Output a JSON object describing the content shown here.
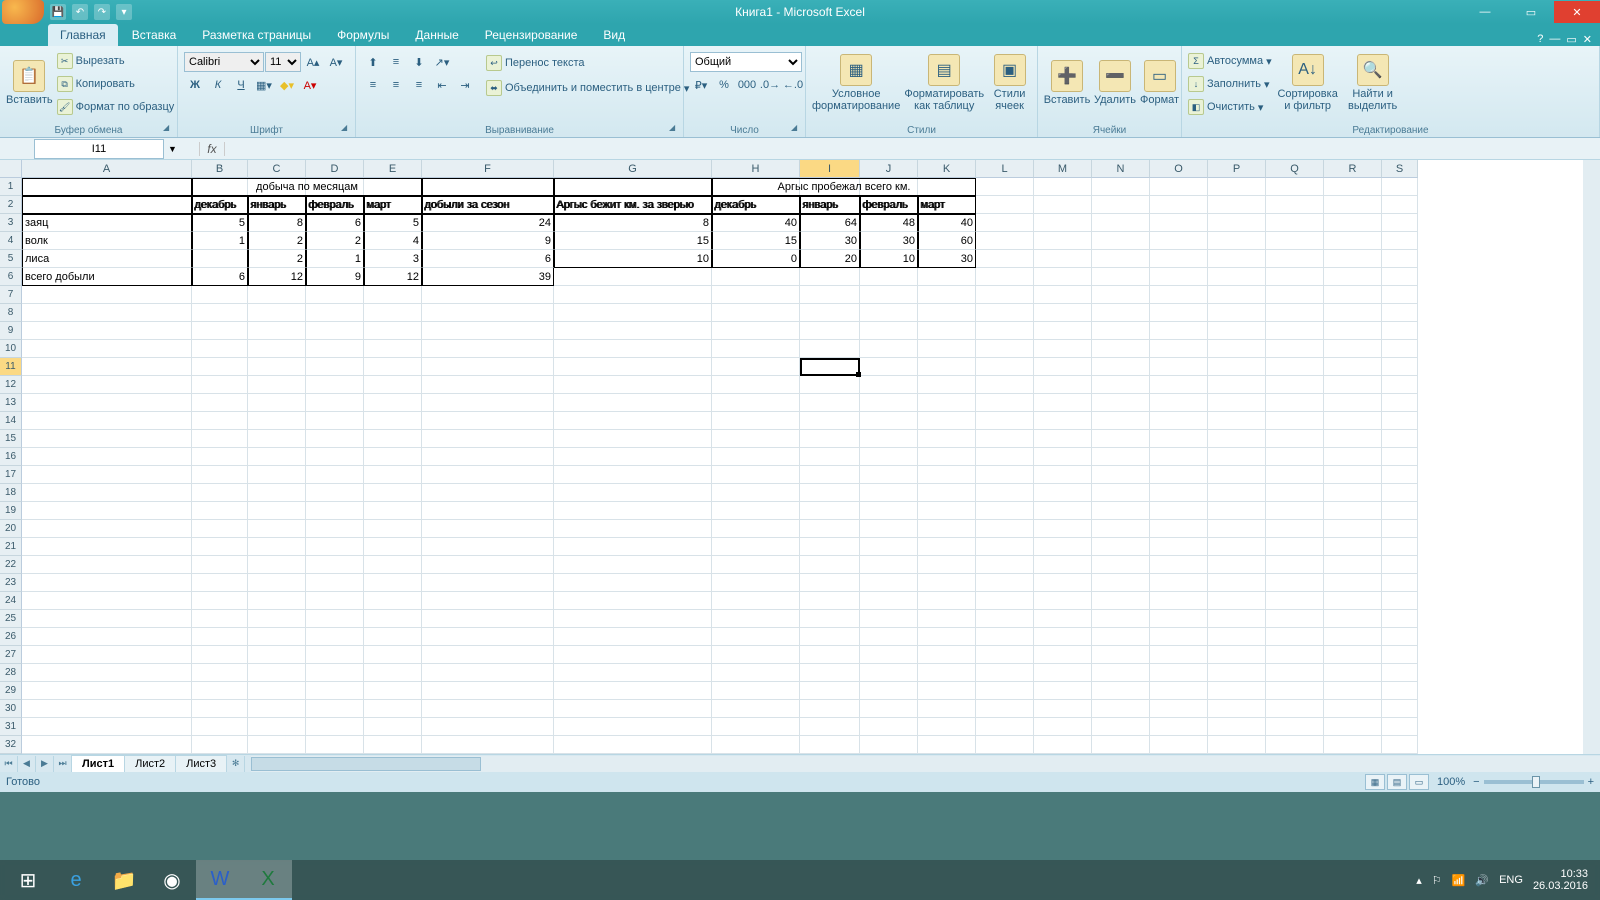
{
  "title": "Книга1 - Microsoft Excel",
  "qat": {
    "save": "💾",
    "undo": "↶",
    "redo": "↷"
  },
  "tabs": [
    "Главная",
    "Вставка",
    "Разметка страницы",
    "Формулы",
    "Данные",
    "Рецензирование",
    "Вид"
  ],
  "activeTab": 0,
  "ribbon": {
    "paste": "Вставить",
    "cut": "Вырезать",
    "copy": "Копировать",
    "formatPainter": "Формат по образцу",
    "clipboard": "Буфер обмена",
    "font": "Calibri",
    "fontSize": "11",
    "fontGroup": "Шрифт",
    "wrap": "Перенос текста",
    "merge": "Объединить и поместить в центре",
    "alignGroup": "Выравнивание",
    "numFormat": "Общий",
    "numGroup": "Число",
    "condFmt": "Условное форматирование",
    "fmtTable": "Форматировать как таблицу",
    "cellStyles": "Стили ячеек",
    "stylesGroup": "Стили",
    "insert": "Вставить",
    "delete": "Удалить",
    "format": "Формат",
    "cellsGroup": "Ячейки",
    "autosum": "Автосумма",
    "fill": "Заполнить",
    "clear": "Очистить",
    "sort": "Сортировка и фильтр",
    "find": "Найти и выделить",
    "editGroup": "Редактирование"
  },
  "nameBox": "I11",
  "fx": "fx",
  "colWidths": {
    "A": 170,
    "B": 56,
    "C": 58,
    "D": 58,
    "E": 58,
    "F": 132,
    "G": 158,
    "H": 88,
    "I": 60,
    "J": 58,
    "K": 58,
    "L": 58,
    "M": 58,
    "N": 58,
    "O": 58,
    "P": 58,
    "Q": 58,
    "R": 58,
    "S": 36
  },
  "cols": [
    "A",
    "B",
    "C",
    "D",
    "E",
    "F",
    "G",
    "H",
    "I",
    "J",
    "K",
    "L",
    "M",
    "N",
    "O",
    "P",
    "Q",
    "R",
    "S"
  ],
  "activeCol": "I",
  "rows": 32,
  "activeRow": 11,
  "chart_data": {
    "type": "table",
    "merged": [
      {
        "cell": "B1",
        "colspan": 4,
        "text": "добыча по месяцам",
        "center": true
      },
      {
        "cell": "H1",
        "colspan": 4,
        "text": "Аргыс пробежал всего км.",
        "center": true
      }
    ],
    "headers2": {
      "B": "декабрь",
      "C": "январь",
      "D": "февраль",
      "E": "март",
      "F": "добыли за сезон",
      "G": "Аргыс бежит км. за зверью",
      "H": "декабрь",
      "I": "январь",
      "J": "февраль",
      "K": "март"
    },
    "rows": [
      {
        "A": "заяц",
        "B": 5,
        "C": 8,
        "D": 6,
        "E": 5,
        "F": 24,
        "G": 8,
        "H": 40,
        "I": 64,
        "J": 48,
        "K": 40
      },
      {
        "A": "волк",
        "B": 1,
        "C": 2,
        "D": 2,
        "E": 4,
        "F": 9,
        "G": 15,
        "H": 15,
        "I": 30,
        "J": 30,
        "K": 60
      },
      {
        "A": "лиса",
        "B": "",
        "C": 2,
        "D": 1,
        "E": 3,
        "F": 6,
        "G": 10,
        "H": 0,
        "I": 20,
        "J": 10,
        "K": 30
      },
      {
        "A": "всего добыли",
        "B": 6,
        "C": 12,
        "D": 9,
        "E": 12,
        "F": 39,
        "G": "",
        "H": "",
        "I": "",
        "J": "",
        "K": ""
      }
    ],
    "dataRowStart": 3
  },
  "sheets": [
    "Лист1",
    "Лист2",
    "Лист3"
  ],
  "activeSheet": 0,
  "status": "Готово",
  "zoom": "100%",
  "tray": {
    "lang": "ENG",
    "time": "10:33",
    "date": "26.03.2016"
  }
}
